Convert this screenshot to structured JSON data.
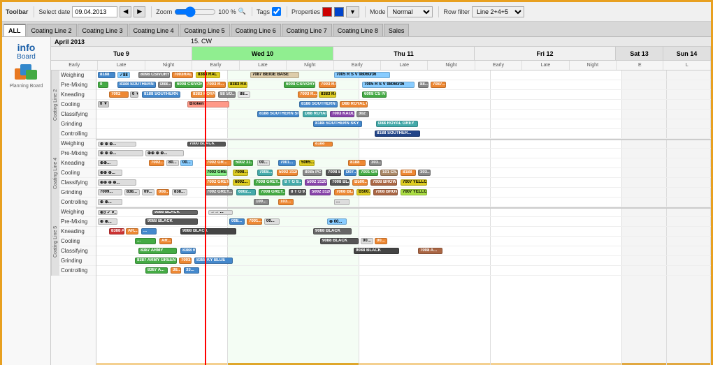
{
  "toolbar": {
    "title": "Toolbar",
    "select_date_label": "Select date",
    "date_value": "09.04.2013",
    "zoom_label": "Zoom",
    "zoom_value": "100 %",
    "tags_label": "Tags",
    "properties_label": "Properties",
    "mode_label": "Mode",
    "mode_value": "Normal",
    "row_filter_label": "Row filter",
    "row_filter_value": "Line 2+4+5",
    "color_red": "#cc0000",
    "color_blue": "#0044cc"
  },
  "tabs": {
    "items": [
      {
        "label": "ALL",
        "active": true
      },
      {
        "label": "Coating Line 2"
      },
      {
        "label": "Coating Line 3"
      },
      {
        "label": "Coating Line 4"
      },
      {
        "label": "Coating Line 5"
      },
      {
        "label": "Coating Line 6"
      },
      {
        "label": "Coating Line 7"
      },
      {
        "label": "Coating Line 8"
      },
      {
        "label": "Sales"
      }
    ]
  },
  "header": {
    "month": "April 2013",
    "cw_label": "15. CW",
    "days": [
      {
        "name": "Tue 9",
        "short": "Tue 9",
        "highlight": false,
        "weekend": false
      },
      {
        "name": "Wed 10",
        "short": "Wed 10",
        "highlight": true,
        "weekend": false
      },
      {
        "name": "Thu 11",
        "short": "Thu 11",
        "highlight": false,
        "weekend": false
      },
      {
        "name": "Fri 12",
        "short": "Fri 12",
        "highlight": false,
        "weekend": false
      },
      {
        "name": "Sat 13",
        "short": "13",
        "highlight": false,
        "weekend": true
      },
      {
        "name": "Sun 14",
        "short": "14",
        "highlight": false,
        "weekend": true
      }
    ],
    "shifts": [
      "Early",
      "Late",
      "Night",
      "Early",
      "Late",
      "Night",
      "Early",
      "Late",
      "Night",
      "Early",
      "Late",
      "Night",
      "E",
      "L"
    ]
  },
  "info_panel": {
    "title": "info",
    "board": "Board"
  },
  "line_groups": [
    {
      "label": "Coating Line 2",
      "rows": [
        "Weighing",
        "Pre-Mixing",
        "Kneading",
        "Cooling",
        "Classifying",
        "Grinding",
        "Controlling"
      ]
    },
    {
      "label": "Coating Line 4",
      "rows": [
        "Weighing",
        "Pre-Mixing",
        "Kneading",
        "Cooling",
        "Classifying",
        "Grinding",
        "Controlling"
      ]
    },
    {
      "label": "Coating Line 5",
      "rows": [
        "Weighing",
        "Pre-Mixing",
        "Kneading",
        "Cooling",
        "Classifying",
        "Grinding",
        "Controlling"
      ]
    }
  ]
}
